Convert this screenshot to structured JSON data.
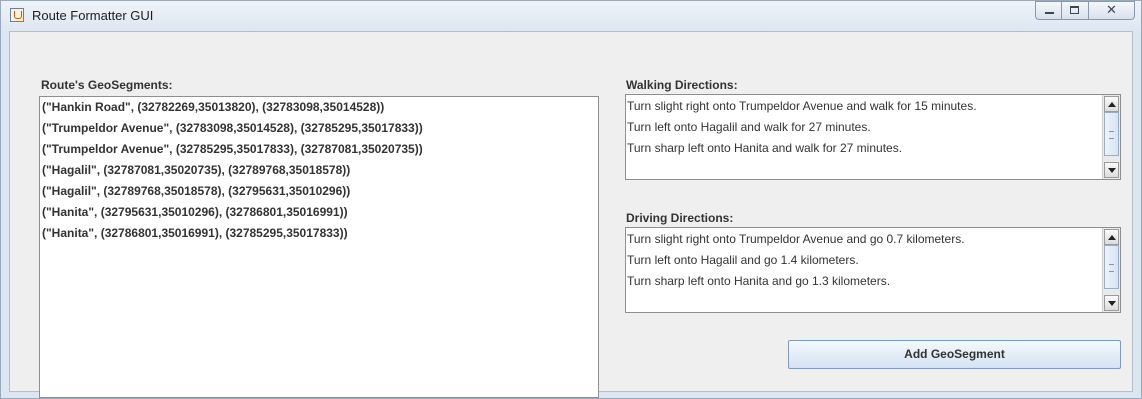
{
  "window": {
    "title": "Route Formatter GUI",
    "close_glyph": "✕"
  },
  "segments": {
    "label": "Route's GeoSegments:",
    "items": [
      "(\"Hankin Road\", (32782269,35013820), (32783098,35014528))",
      "(\"Trumpeldor Avenue\", (32783098,35014528), (32785295,35017833))",
      "(\"Trumpeldor Avenue\", (32785295,35017833), (32787081,35020735))",
      "(\"Hagalil\", (32787081,35020735), (32789768,35018578))",
      "(\"Hagalil\", (32789768,35018578), (32795631,35010296))",
      "(\"Hanita\", (32795631,35010296), (32786801,35016991))",
      "(\"Hanita\", (32786801,35016991), (32785295,35017833))"
    ]
  },
  "walking": {
    "label": "Walking Directions:",
    "lines": [
      "Turn slight right onto Trumpeldor Avenue and walk for 15 minutes.",
      "Turn left onto Hagalil and walk for 27 minutes.",
      "Turn sharp left onto Hanita and walk for 27 minutes."
    ]
  },
  "driving": {
    "label": "Driving Directions:",
    "lines": [
      "Turn slight right onto Trumpeldor Avenue and go 0.7 kilometers.",
      "Turn left onto Hagalil and go 1.4 kilometers.",
      "Turn sharp left onto Hanita and go 1.3 kilometers."
    ]
  },
  "add_button": {
    "label": "Add GeoSegment"
  }
}
